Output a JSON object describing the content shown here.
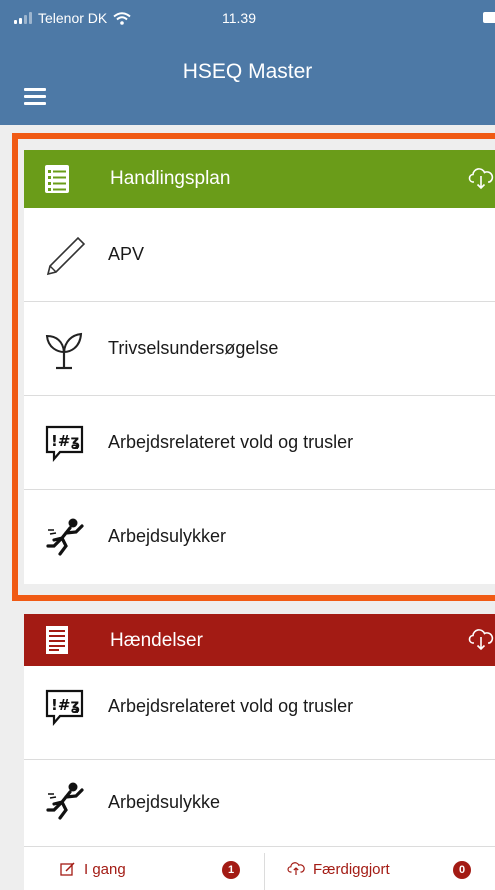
{
  "status_bar": {
    "carrier": "Telenor DK",
    "time": "11.39"
  },
  "nav": {
    "title": "HSEQ Master"
  },
  "sections": [
    {
      "title": "Handlingsplan",
      "header_color": "#6a9c19",
      "icon": "checklist-icon",
      "items": [
        {
          "label": "APV",
          "icon": "pencil-icon"
        },
        {
          "label": "Trivselsundersøgelse",
          "icon": "sprout-icon"
        },
        {
          "label": "Arbejdsrelateret vold og trusler",
          "icon": "swear-speech-bubble-icon"
        },
        {
          "label": "Arbejdsulykker",
          "icon": "falling-person-icon"
        }
      ]
    },
    {
      "title": "Hændelser",
      "header_color": "#a31b14",
      "icon": "document-list-icon",
      "items": [
        {
          "label": "Arbejdsrelateret vold og trusler",
          "icon": "swear-speech-bubble-icon"
        },
        {
          "label": "Arbejdsulykke",
          "icon": "falling-person-icon"
        }
      ]
    }
  ],
  "tabs": [
    {
      "label": "I gang",
      "count": "1",
      "icon": "edit-icon"
    },
    {
      "label": "Færdiggjort",
      "count": "0",
      "icon": "cloud-icon"
    }
  ],
  "colors": {
    "navbar": "#4d79a6",
    "highlight_border": "#f05a14",
    "accent_red": "#a31b14",
    "accent_green": "#6a9c19"
  }
}
